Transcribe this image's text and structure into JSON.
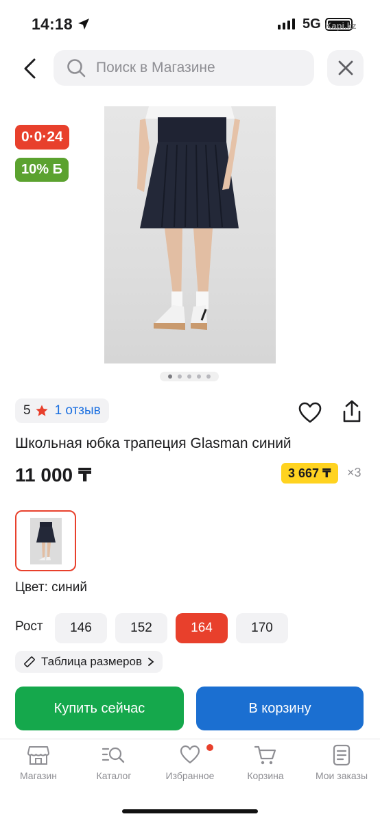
{
  "status_bar": {
    "time": "14:18",
    "network": "5G",
    "watermark": "Kapi.kz"
  },
  "search": {
    "placeholder": "Поиск в Магазине"
  },
  "badges": {
    "timer": "0·0·24",
    "bonus": "10% Б"
  },
  "gallery": {
    "total_images": 5,
    "active_index": 0
  },
  "rating": {
    "score": "5",
    "reviews": "1 отзыв"
  },
  "product": {
    "title": "Школьная юбка трапеция Glasman синий",
    "price": "11 000 ₸",
    "installment_price": "3 667 ₸",
    "installment_times": "×3"
  },
  "color": {
    "label": "Цвет: синий"
  },
  "sizes": {
    "label": "Рост",
    "options": [
      "146",
      "152",
      "164",
      "170"
    ],
    "selected": "164",
    "table_link": "Таблица размеров"
  },
  "actions": {
    "buy_now": "Купить сейчас",
    "add_to_cart": "В корзину"
  },
  "tabbar": {
    "items": [
      {
        "label": "Магазин",
        "icon": "store-icon"
      },
      {
        "label": "Каталог",
        "icon": "catalog-search-icon"
      },
      {
        "label": "Избранное",
        "icon": "heart-icon"
      },
      {
        "label": "Корзина",
        "icon": "cart-icon"
      },
      {
        "label": "Мои заказы",
        "icon": "orders-icon"
      }
    ]
  },
  "colors": {
    "accent_red": "#e8402c",
    "bonus_green": "#5ba22f",
    "buy_green": "#15a84c",
    "cart_blue": "#1b6fd1",
    "installment_yellow": "#ffd320",
    "link_blue": "#1a6fe0"
  }
}
